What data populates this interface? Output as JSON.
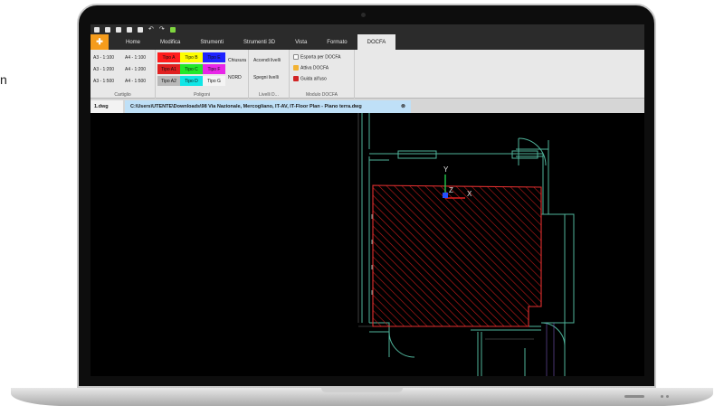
{
  "quick_access": [
    "new-icon",
    "open-icon",
    "save-icon",
    "saveas-icon",
    "print-icon",
    "undo-icon",
    "redo-icon",
    "export-icon"
  ],
  "app_button": "",
  "tabs": [
    "Home",
    "Modifica",
    "Strumenti",
    "Strumenti 3D",
    "Vista",
    "Formato",
    "DOCFA"
  ],
  "active_tab": "DOCFA",
  "ribbon": {
    "cartiglio": {
      "label": "Cartiglio",
      "items": [
        "A3 - 1:100",
        "A4 - 1:100",
        "A3 - 1:200",
        "A4 - 1:200",
        "A3 - 1:500",
        "A4 - 1:500"
      ]
    },
    "poligoni": {
      "label": "Poligoni",
      "swatches": [
        {
          "label": "Tipo A",
          "color": "#ff1c1c"
        },
        {
          "label": "Tipo B",
          "color": "#ffff00"
        },
        {
          "label": "Tipo E",
          "color": "#1e22ff"
        },
        {
          "label": "Tipo A1",
          "color": "#e02020"
        },
        {
          "label": "Tipo C",
          "color": "#22e82a"
        },
        {
          "label": "Tipo F",
          "color": "#e826e8"
        },
        {
          "label": "Tipo A2",
          "color": "#b9b9b9"
        },
        {
          "label": "Tipo D",
          "color": "#11e6e6"
        },
        {
          "label": "Tipo G",
          "color": "#f4f4f4"
        }
      ],
      "chiusura": "Chiusura",
      "nord": "NORD"
    },
    "livelli": {
      "label": "Livelli D...",
      "accendi": "Accendi livelli",
      "spegni": "Spegni livelli"
    },
    "modulo": {
      "label": "Modulo DOCFA",
      "esporta": "Esporta per DOCFA",
      "attiva": "Attiva DOCFA",
      "guida": "Guida all'uso"
    }
  },
  "document": {
    "tab": "1.dwg",
    "path": "C:\\Users\\UTENTE\\Downloads\\98 Via Nazionale, Mercogliano, IT-AV, IT-Floor Plan - Piano terra.dwg",
    "close_glyph": "⊗"
  },
  "axes": {
    "y": "Y",
    "z": "Z",
    "x": "X"
  },
  "colors": {
    "accent": "#f59c1c",
    "hatch": "#c41a1a",
    "wall": "#4fb39a"
  }
}
